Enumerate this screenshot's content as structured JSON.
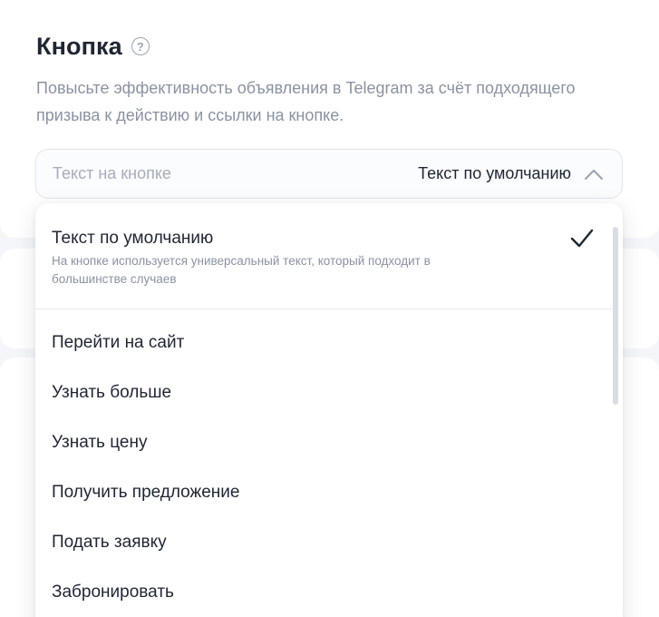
{
  "section": {
    "title": "Кнопка",
    "help_icon_glyph": "?",
    "description": "Повысьте эффективность объявления в Telegram за счёт подходящего призыва к действию и ссылки на кнопке."
  },
  "select": {
    "placeholder": "Текст на кнопке",
    "value": "Текст по умолчанию",
    "icon": "chevron-up-icon"
  },
  "dropdown": {
    "selected": {
      "label": "Текст по умолчанию",
      "description": "На кнопке используется универсальный текст, который подходит в большинстве случаев",
      "icon": "check-icon"
    },
    "options": [
      "Перейти на сайт",
      "Узнать больше",
      "Узнать цену",
      "Получить предложение",
      "Подать заявку",
      "Забронировать"
    ]
  },
  "colors": {
    "text_primary": "#1f2633",
    "text_secondary": "#8a92a1",
    "border": "#e1e5eb",
    "background": "#f4f6f9"
  }
}
